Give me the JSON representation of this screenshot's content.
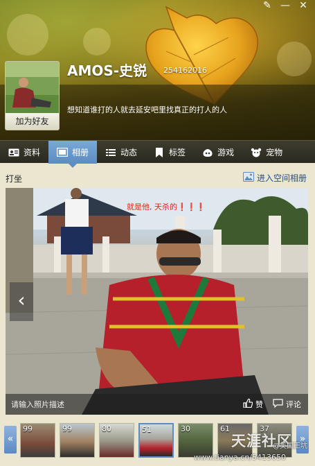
{
  "window": {
    "controls": [
      "✎",
      "—",
      "✕"
    ]
  },
  "profile": {
    "name": "AMOS-史锐",
    "qq_number": "254162016",
    "signature": "想知道谁打的人就去延安吧里找真正的打人的人",
    "add_friend_label": "加为好友"
  },
  "nav": {
    "tabs": [
      {
        "label": "资料",
        "icon": "id-card-icon"
      },
      {
        "label": "相册",
        "icon": "photo-album-icon",
        "active": true
      },
      {
        "label": "动态",
        "icon": "list-icon"
      },
      {
        "label": "标签",
        "icon": "bookmark-icon"
      },
      {
        "label": "游戏",
        "icon": "game-icon"
      },
      {
        "label": "宠物",
        "icon": "pet-icon"
      }
    ]
  },
  "album": {
    "title": "打坐",
    "enter_label": "进入空间相册",
    "photo_caption": "就是他, 天杀的❗❗❗",
    "description_placeholder": "请输入照片描述",
    "like_label": "赞",
    "comment_label": "评论"
  },
  "thumbnails": [
    {
      "count": "99"
    },
    {
      "count": "99"
    },
    {
      "count": "80"
    },
    {
      "count": "51",
      "selected": true
    },
    {
      "count": "30"
    },
    {
      "count": "61"
    },
    {
      "count": "37"
    }
  ],
  "watermark": {
    "site": "天涯社区",
    "handle": "@美国王坑",
    "url": "www.tianya.cn/5413650"
  },
  "colors": {
    "accent": "#5c8cc0",
    "caption_red": "#e0261d",
    "nav_dark": "#2a291f"
  }
}
